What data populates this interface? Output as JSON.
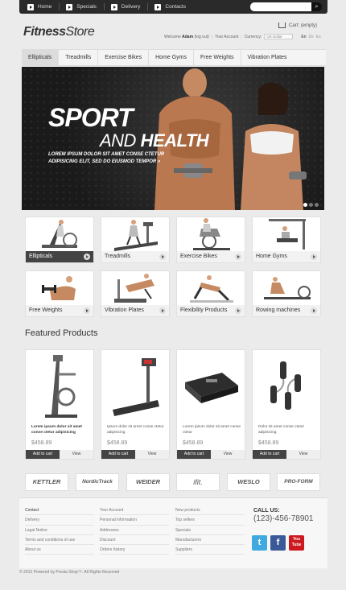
{
  "topnav": [
    {
      "label": "Home"
    },
    {
      "label": "Specials"
    },
    {
      "label": "Delivery"
    },
    {
      "label": "Contacts"
    }
  ],
  "search": {
    "placeholder": ""
  },
  "logo": {
    "part1": "Fitness",
    "part2": "Store"
  },
  "cart": {
    "label": "Cart:",
    "status": "(empty)"
  },
  "userbar": {
    "welcome": "Welcome",
    "user": "Adam",
    "logout": "(log out)",
    "account": "Your Account",
    "currency_label": "Currency:",
    "currency_value": "US Dollar",
    "lang_active": "En",
    "lang_other1": "De",
    "lang_other2": "Es"
  },
  "mainnav": [
    {
      "label": "Ellipticals"
    },
    {
      "label": "Treadmills"
    },
    {
      "label": "Exercise Bikes"
    },
    {
      "label": "Home Gyms"
    },
    {
      "label": "Free Weights"
    },
    {
      "label": "Vibration Plates"
    }
  ],
  "banner": {
    "title1": "SPORT",
    "title2_light": "AND ",
    "title2_bold": "HEALTH",
    "subtitle": "LOREM IPSUM DOLOR SIT AMET CONSE CTETUR ADIPISICING ELIT, SED DO EIUSMOD TEMPOR »"
  },
  "categories": [
    {
      "label": "Ellipticals"
    },
    {
      "label": "Treadmills"
    },
    {
      "label": "Exercise Bikes"
    },
    {
      "label": "Home Gyms"
    },
    {
      "label": "Free Weights"
    },
    {
      "label": "Vibration Plates"
    },
    {
      "label": "Flexibility Products"
    },
    {
      "label": "Rowing machines"
    }
  ],
  "featured": {
    "title": "Featured Products"
  },
  "products": [
    {
      "desc": "Lorem ipsum dolor sit amet conse ctetur adipisicing",
      "price": "$458.89",
      "add": "Add to cart",
      "view": "View"
    },
    {
      "desc": "Ipsum dolor sit amet conse ctetur adipisicing",
      "price": "$458.89",
      "add": "Add to cart",
      "view": "View"
    },
    {
      "desc": "Lorem ipsum dolor sit amet conse ctetur",
      "price": "$458.89",
      "add": "Add to cart",
      "view": "View"
    },
    {
      "desc": "Dolor sit amet conse ctetur adipisicing",
      "price": "$458.89",
      "add": "Add to cart",
      "view": "View"
    }
  ],
  "brands": [
    {
      "label": "KETTLER"
    },
    {
      "label": "NordicTrack"
    },
    {
      "label": "WEIDER"
    },
    {
      "label": "ifit."
    },
    {
      "label": "WESLO"
    },
    {
      "label": "PRO-FORM"
    }
  ],
  "footer": {
    "col1": [
      "Contact",
      "Delivery",
      "Legal Notice",
      "Terms and conditions of use",
      "About us"
    ],
    "col2": [
      "Your Account",
      "Personal information",
      "Addresses",
      "Discount",
      "Orders history"
    ],
    "col3": [
      "New products",
      "Top sellers",
      "Specials",
      "Manufacturers",
      "Suppliers"
    ],
    "call_label": "CALL US:",
    "phone": "(123)-456-78901"
  },
  "social": [
    {
      "label": "t"
    },
    {
      "label": "f"
    },
    {
      "label": "You Tube"
    }
  ],
  "copyright": "© 2012 Powered by Presta Shop™. All Rights Reserved",
  "colors": {
    "dark": "#2a2a2a",
    "accent": "#444444",
    "twitter": "#3fa9e0",
    "facebook": "#3b5998",
    "youtube": "#cc181e"
  }
}
